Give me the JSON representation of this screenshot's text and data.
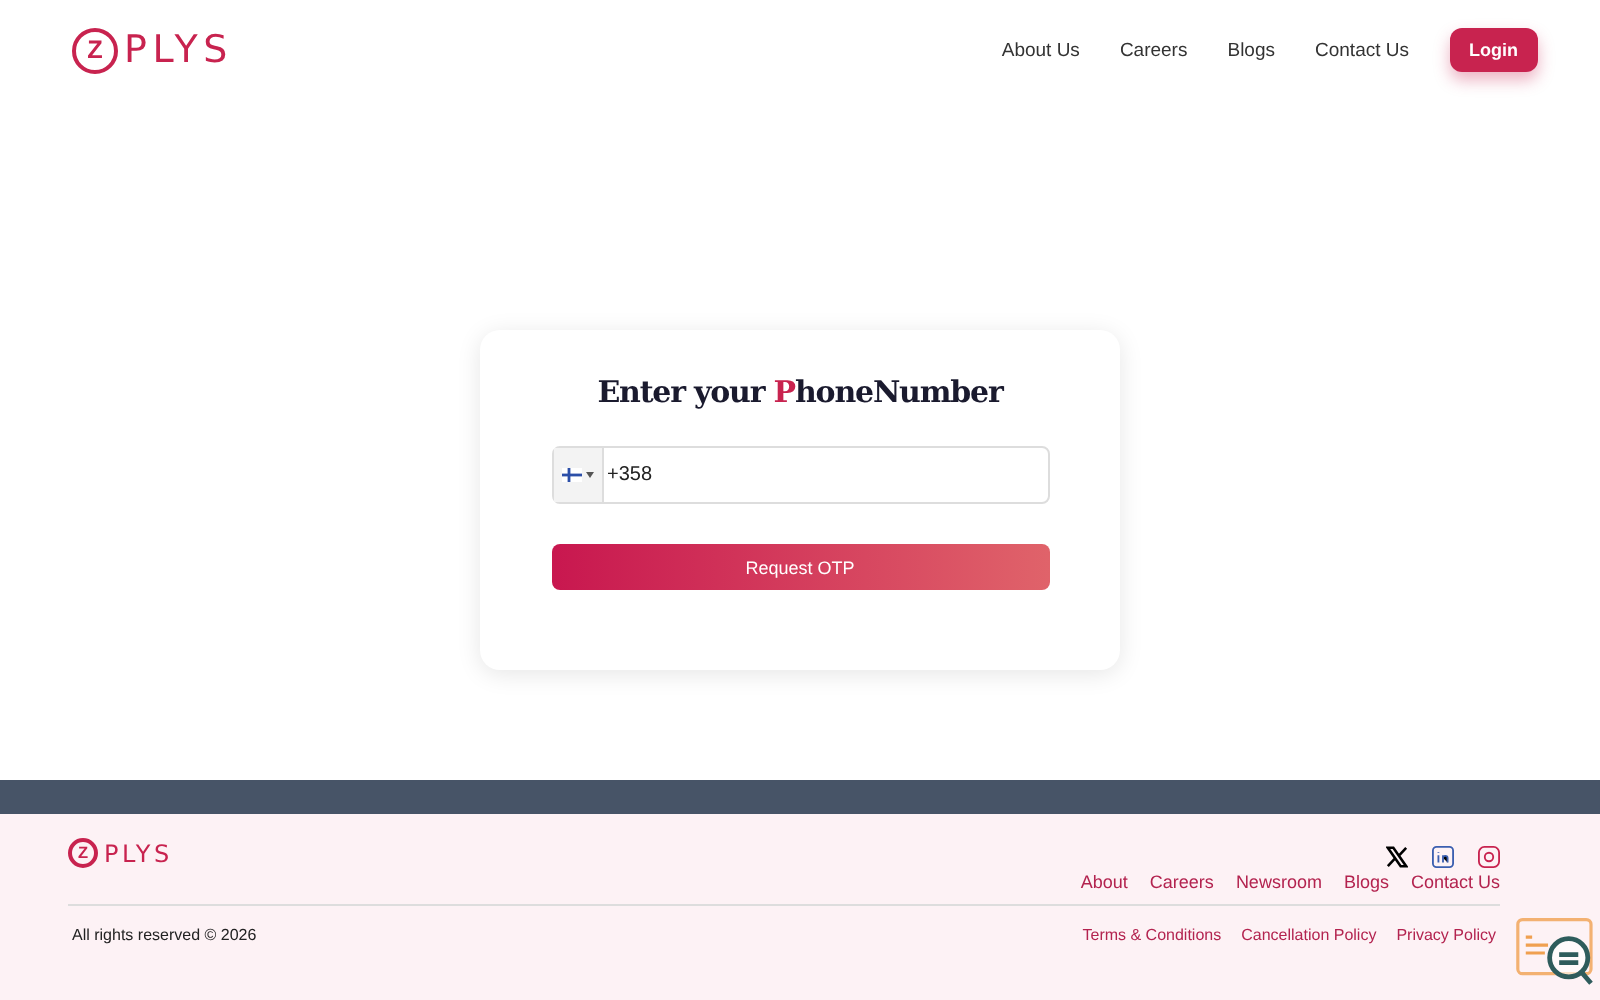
{
  "header": {
    "logo": {
      "mark": "Z",
      "text": "PLYS"
    },
    "nav": [
      "About Us",
      "Careers",
      "Blogs",
      "Contact Us"
    ],
    "login": "Login"
  },
  "card": {
    "title_parts": [
      "Enter your ",
      "P",
      "honeNumber"
    ],
    "phone": {
      "country_code": "+358"
    },
    "button": "Request OTP"
  },
  "footer": {
    "logo": {
      "mark": "Z",
      "text": "PLYS"
    },
    "links": [
      "About",
      "Careers",
      "Newsroom",
      "Blogs",
      "Contact Us"
    ],
    "copyright": "All rights reserved © 2026",
    "legal": [
      "Terms & Conditions",
      "Cancellation Policy",
      "Privacy Policy"
    ]
  }
}
